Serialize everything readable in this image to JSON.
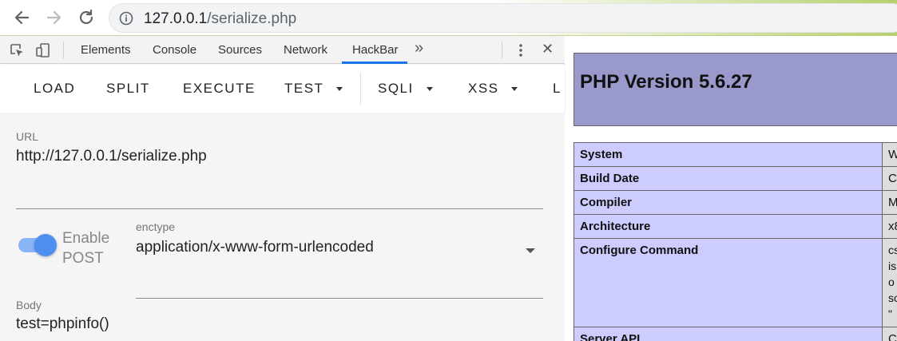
{
  "browser": {
    "url_host": "127.0.0.1",
    "url_path": "/serialize.php"
  },
  "devtools": {
    "tabs": [
      "Elements",
      "Console",
      "Sources",
      "Network",
      "HackBar"
    ],
    "more": "»",
    "close": "✕"
  },
  "hackbar": {
    "menu": [
      "LOAD",
      "SPLIT",
      "EXECUTE",
      "TEST",
      "SQLI",
      "XSS",
      "L"
    ],
    "url_label": "URL",
    "url_value": "http://127.0.0.1/serialize.php",
    "enable_post_line1": "Enable",
    "enable_post_line2": "POST",
    "enable_post_on": true,
    "enctype_label": "enctype",
    "enctype_value": "application/x-www-form-urlencoded",
    "body_label": "Body",
    "body_value": "test=phpinfo()"
  },
  "php": {
    "title": "PHP Version 5.6.27",
    "rows": [
      {
        "key": "System",
        "val": "W"
      },
      {
        "key": "Build Date",
        "val": "C"
      },
      {
        "key": "Compiler",
        "val": "M"
      },
      {
        "key": "Architecture",
        "val": "x8"
      },
      {
        "key": "Configure Command",
        "val_lines": [
          "cs",
          "is",
          "o",
          "sc",
          "\""
        ]
      },
      {
        "key": "Server API",
        "val": "C"
      }
    ]
  },
  "colors": {
    "accent_blue": "#1a73e8",
    "php_header": "#9999cc",
    "php_key": "#ccccff",
    "php_val": "#dddddd"
  }
}
